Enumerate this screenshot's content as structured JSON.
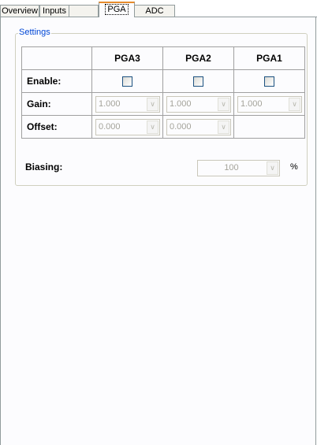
{
  "tabs": [
    {
      "label": "Overview"
    },
    {
      "label": "Inputs"
    },
    {
      "label": "PGA",
      "active": true
    },
    {
      "label": "ADC"
    }
  ],
  "settings": {
    "title": "Settings",
    "columns": [
      "PGA3",
      "PGA2",
      "PGA1"
    ],
    "enable": {
      "label": "Enable:",
      "values": [
        false,
        false,
        false
      ]
    },
    "gain": {
      "label": "Gain:",
      "values": [
        "1.000",
        "1.000",
        "1.000"
      ]
    },
    "offset": {
      "label": "Offset:",
      "values": [
        "0.000",
        "0.000"
      ]
    },
    "biasing": {
      "label": "Biasing:",
      "value": "100",
      "unit": "%"
    }
  },
  "icons": {
    "dropdown": "chevron-down-icon"
  }
}
